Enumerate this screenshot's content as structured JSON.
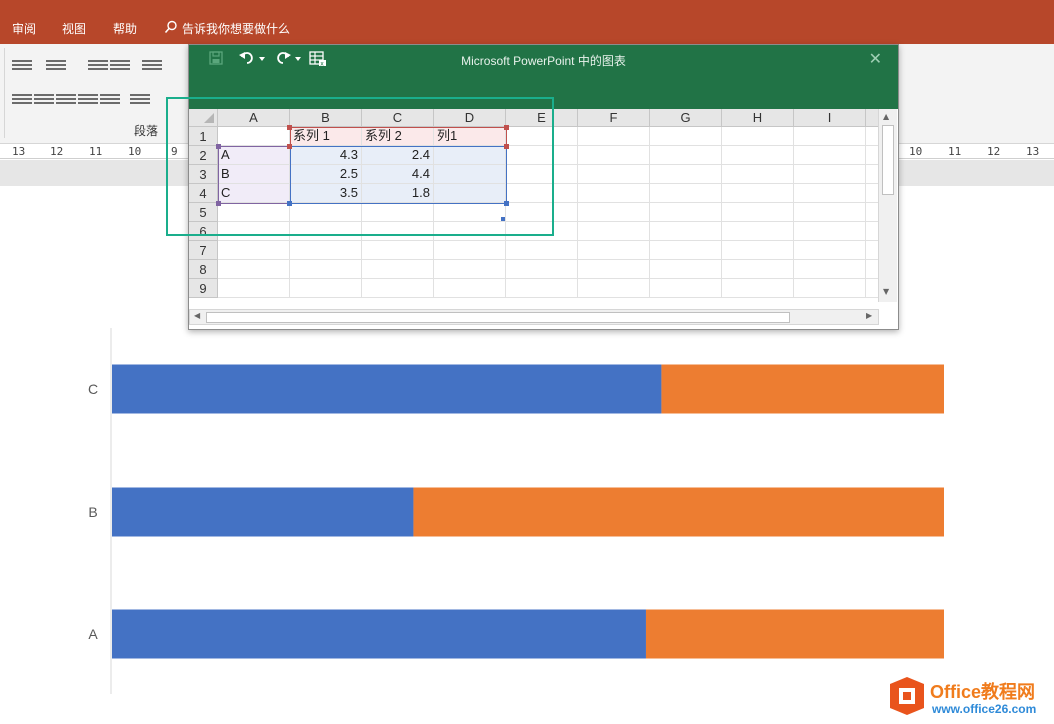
{
  "ppt": {
    "tabs": [
      "审阅",
      "视图",
      "帮助"
    ],
    "search_label": "告诉我你想要做什么",
    "ribbon_group": "段落",
    "ruler_left": [
      "13",
      "12",
      "11",
      "10",
      "9"
    ],
    "ruler_right": [
      "10",
      "11",
      "12",
      "13"
    ],
    "colors": {
      "titlebar": "#b7472a"
    }
  },
  "excel": {
    "title": "Microsoft PowerPoint 中的图表",
    "toolbar": {
      "save": "save-icon",
      "undo": "undo-icon",
      "redo": "redo-icon",
      "table": "edit-data-table-icon"
    },
    "columns": [
      "A",
      "B",
      "C",
      "D",
      "E",
      "F",
      "G",
      "H",
      "I"
    ],
    "rows": [
      "1",
      "2",
      "3",
      "4",
      "5",
      "6",
      "7",
      "8",
      "9"
    ],
    "cells": {
      "B1": "系列 1",
      "C1": "系列 2",
      "D1": "列1",
      "A2": "A",
      "B2": "4.3",
      "C2": "2.4",
      "A3": "B",
      "B3": "2.5",
      "C3": "4.4",
      "A4": "C",
      "B4": "3.5",
      "C4": "1.8"
    },
    "colors": {
      "titlebar": "#217346"
    }
  },
  "chart_data": {
    "type": "bar",
    "orientation": "horizontal",
    "stacked": "percent",
    "categories": [
      "A",
      "B",
      "C"
    ],
    "series": [
      {
        "name": "系列 1",
        "values": [
          4.3,
          2.5,
          3.5
        ],
        "color": "#4472c4"
      },
      {
        "name": "系列 2",
        "values": [
          2.4,
          4.4,
          1.8
        ],
        "color": "#ed7d31"
      }
    ],
    "title": "",
    "xlabel": "",
    "ylabel": "",
    "grid": false,
    "legend": "none"
  },
  "watermark": {
    "brand": "Office教程网",
    "url": "www.office26.com"
  }
}
